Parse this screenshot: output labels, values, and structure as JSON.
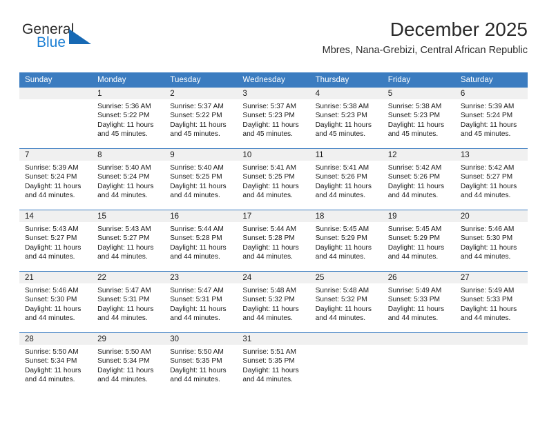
{
  "brand": {
    "name_top": "General",
    "name_bottom": "Blue",
    "accent_color": "#1769b4",
    "text_color": "#2b2b2b"
  },
  "header": {
    "title": "December 2025",
    "subtitle": "Mbres, Nana-Grebizi, Central African Republic"
  },
  "theme": {
    "header_row_bg": "#3b7cc0",
    "header_row_text": "#ffffff",
    "daynum_band_bg": "#f0f0f0",
    "row_divider": "#3b7cc0",
    "body_text": "#1a1a1a"
  },
  "weekday_headers": [
    "Sunday",
    "Monday",
    "Tuesday",
    "Wednesday",
    "Thursday",
    "Friday",
    "Saturday"
  ],
  "weeks": [
    [
      {
        "day": "",
        "sunrise": "",
        "sunset": "",
        "daylight_line1": "",
        "daylight_line2": "",
        "empty": true
      },
      {
        "day": "1",
        "sunrise": "Sunrise: 5:36 AM",
        "sunset": "Sunset: 5:22 PM",
        "daylight_line1": "Daylight: 11 hours",
        "daylight_line2": "and 45 minutes.",
        "empty": false
      },
      {
        "day": "2",
        "sunrise": "Sunrise: 5:37 AM",
        "sunset": "Sunset: 5:22 PM",
        "daylight_line1": "Daylight: 11 hours",
        "daylight_line2": "and 45 minutes.",
        "empty": false
      },
      {
        "day": "3",
        "sunrise": "Sunrise: 5:37 AM",
        "sunset": "Sunset: 5:23 PM",
        "daylight_line1": "Daylight: 11 hours",
        "daylight_line2": "and 45 minutes.",
        "empty": false
      },
      {
        "day": "4",
        "sunrise": "Sunrise: 5:38 AM",
        "sunset": "Sunset: 5:23 PM",
        "daylight_line1": "Daylight: 11 hours",
        "daylight_line2": "and 45 minutes.",
        "empty": false
      },
      {
        "day": "5",
        "sunrise": "Sunrise: 5:38 AM",
        "sunset": "Sunset: 5:23 PM",
        "daylight_line1": "Daylight: 11 hours",
        "daylight_line2": "and 45 minutes.",
        "empty": false
      },
      {
        "day": "6",
        "sunrise": "Sunrise: 5:39 AM",
        "sunset": "Sunset: 5:24 PM",
        "daylight_line1": "Daylight: 11 hours",
        "daylight_line2": "and 45 minutes.",
        "empty": false
      }
    ],
    [
      {
        "day": "7",
        "sunrise": "Sunrise: 5:39 AM",
        "sunset": "Sunset: 5:24 PM",
        "daylight_line1": "Daylight: 11 hours",
        "daylight_line2": "and 44 minutes.",
        "empty": false
      },
      {
        "day": "8",
        "sunrise": "Sunrise: 5:40 AM",
        "sunset": "Sunset: 5:24 PM",
        "daylight_line1": "Daylight: 11 hours",
        "daylight_line2": "and 44 minutes.",
        "empty": false
      },
      {
        "day": "9",
        "sunrise": "Sunrise: 5:40 AM",
        "sunset": "Sunset: 5:25 PM",
        "daylight_line1": "Daylight: 11 hours",
        "daylight_line2": "and 44 minutes.",
        "empty": false
      },
      {
        "day": "10",
        "sunrise": "Sunrise: 5:41 AM",
        "sunset": "Sunset: 5:25 PM",
        "daylight_line1": "Daylight: 11 hours",
        "daylight_line2": "and 44 minutes.",
        "empty": false
      },
      {
        "day": "11",
        "sunrise": "Sunrise: 5:41 AM",
        "sunset": "Sunset: 5:26 PM",
        "daylight_line1": "Daylight: 11 hours",
        "daylight_line2": "and 44 minutes.",
        "empty": false
      },
      {
        "day": "12",
        "sunrise": "Sunrise: 5:42 AM",
        "sunset": "Sunset: 5:26 PM",
        "daylight_line1": "Daylight: 11 hours",
        "daylight_line2": "and 44 minutes.",
        "empty": false
      },
      {
        "day": "13",
        "sunrise": "Sunrise: 5:42 AM",
        "sunset": "Sunset: 5:27 PM",
        "daylight_line1": "Daylight: 11 hours",
        "daylight_line2": "and 44 minutes.",
        "empty": false
      }
    ],
    [
      {
        "day": "14",
        "sunrise": "Sunrise: 5:43 AM",
        "sunset": "Sunset: 5:27 PM",
        "daylight_line1": "Daylight: 11 hours",
        "daylight_line2": "and 44 minutes.",
        "empty": false
      },
      {
        "day": "15",
        "sunrise": "Sunrise: 5:43 AM",
        "sunset": "Sunset: 5:27 PM",
        "daylight_line1": "Daylight: 11 hours",
        "daylight_line2": "and 44 minutes.",
        "empty": false
      },
      {
        "day": "16",
        "sunrise": "Sunrise: 5:44 AM",
        "sunset": "Sunset: 5:28 PM",
        "daylight_line1": "Daylight: 11 hours",
        "daylight_line2": "and 44 minutes.",
        "empty": false
      },
      {
        "day": "17",
        "sunrise": "Sunrise: 5:44 AM",
        "sunset": "Sunset: 5:28 PM",
        "daylight_line1": "Daylight: 11 hours",
        "daylight_line2": "and 44 minutes.",
        "empty": false
      },
      {
        "day": "18",
        "sunrise": "Sunrise: 5:45 AM",
        "sunset": "Sunset: 5:29 PM",
        "daylight_line1": "Daylight: 11 hours",
        "daylight_line2": "and 44 minutes.",
        "empty": false
      },
      {
        "day": "19",
        "sunrise": "Sunrise: 5:45 AM",
        "sunset": "Sunset: 5:29 PM",
        "daylight_line1": "Daylight: 11 hours",
        "daylight_line2": "and 44 minutes.",
        "empty": false
      },
      {
        "day": "20",
        "sunrise": "Sunrise: 5:46 AM",
        "sunset": "Sunset: 5:30 PM",
        "daylight_line1": "Daylight: 11 hours",
        "daylight_line2": "and 44 minutes.",
        "empty": false
      }
    ],
    [
      {
        "day": "21",
        "sunrise": "Sunrise: 5:46 AM",
        "sunset": "Sunset: 5:30 PM",
        "daylight_line1": "Daylight: 11 hours",
        "daylight_line2": "and 44 minutes.",
        "empty": false
      },
      {
        "day": "22",
        "sunrise": "Sunrise: 5:47 AM",
        "sunset": "Sunset: 5:31 PM",
        "daylight_line1": "Daylight: 11 hours",
        "daylight_line2": "and 44 minutes.",
        "empty": false
      },
      {
        "day": "23",
        "sunrise": "Sunrise: 5:47 AM",
        "sunset": "Sunset: 5:31 PM",
        "daylight_line1": "Daylight: 11 hours",
        "daylight_line2": "and 44 minutes.",
        "empty": false
      },
      {
        "day": "24",
        "sunrise": "Sunrise: 5:48 AM",
        "sunset": "Sunset: 5:32 PM",
        "daylight_line1": "Daylight: 11 hours",
        "daylight_line2": "and 44 minutes.",
        "empty": false
      },
      {
        "day": "25",
        "sunrise": "Sunrise: 5:48 AM",
        "sunset": "Sunset: 5:32 PM",
        "daylight_line1": "Daylight: 11 hours",
        "daylight_line2": "and 44 minutes.",
        "empty": false
      },
      {
        "day": "26",
        "sunrise": "Sunrise: 5:49 AM",
        "sunset": "Sunset: 5:33 PM",
        "daylight_line1": "Daylight: 11 hours",
        "daylight_line2": "and 44 minutes.",
        "empty": false
      },
      {
        "day": "27",
        "sunrise": "Sunrise: 5:49 AM",
        "sunset": "Sunset: 5:33 PM",
        "daylight_line1": "Daylight: 11 hours",
        "daylight_line2": "and 44 minutes.",
        "empty": false
      }
    ],
    [
      {
        "day": "28",
        "sunrise": "Sunrise: 5:50 AM",
        "sunset": "Sunset: 5:34 PM",
        "daylight_line1": "Daylight: 11 hours",
        "daylight_line2": "and 44 minutes.",
        "empty": false
      },
      {
        "day": "29",
        "sunrise": "Sunrise: 5:50 AM",
        "sunset": "Sunset: 5:34 PM",
        "daylight_line1": "Daylight: 11 hours",
        "daylight_line2": "and 44 minutes.",
        "empty": false
      },
      {
        "day": "30",
        "sunrise": "Sunrise: 5:50 AM",
        "sunset": "Sunset: 5:35 PM",
        "daylight_line1": "Daylight: 11 hours",
        "daylight_line2": "and 44 minutes.",
        "empty": false
      },
      {
        "day": "31",
        "sunrise": "Sunrise: 5:51 AM",
        "sunset": "Sunset: 5:35 PM",
        "daylight_line1": "Daylight: 11 hours",
        "daylight_line2": "and 44 minutes.",
        "empty": false
      },
      {
        "day": "",
        "sunrise": "",
        "sunset": "",
        "daylight_line1": "",
        "daylight_line2": "",
        "empty": true
      },
      {
        "day": "",
        "sunrise": "",
        "sunset": "",
        "daylight_line1": "",
        "daylight_line2": "",
        "empty": true
      },
      {
        "day": "",
        "sunrise": "",
        "sunset": "",
        "daylight_line1": "",
        "daylight_line2": "",
        "empty": true
      }
    ]
  ]
}
